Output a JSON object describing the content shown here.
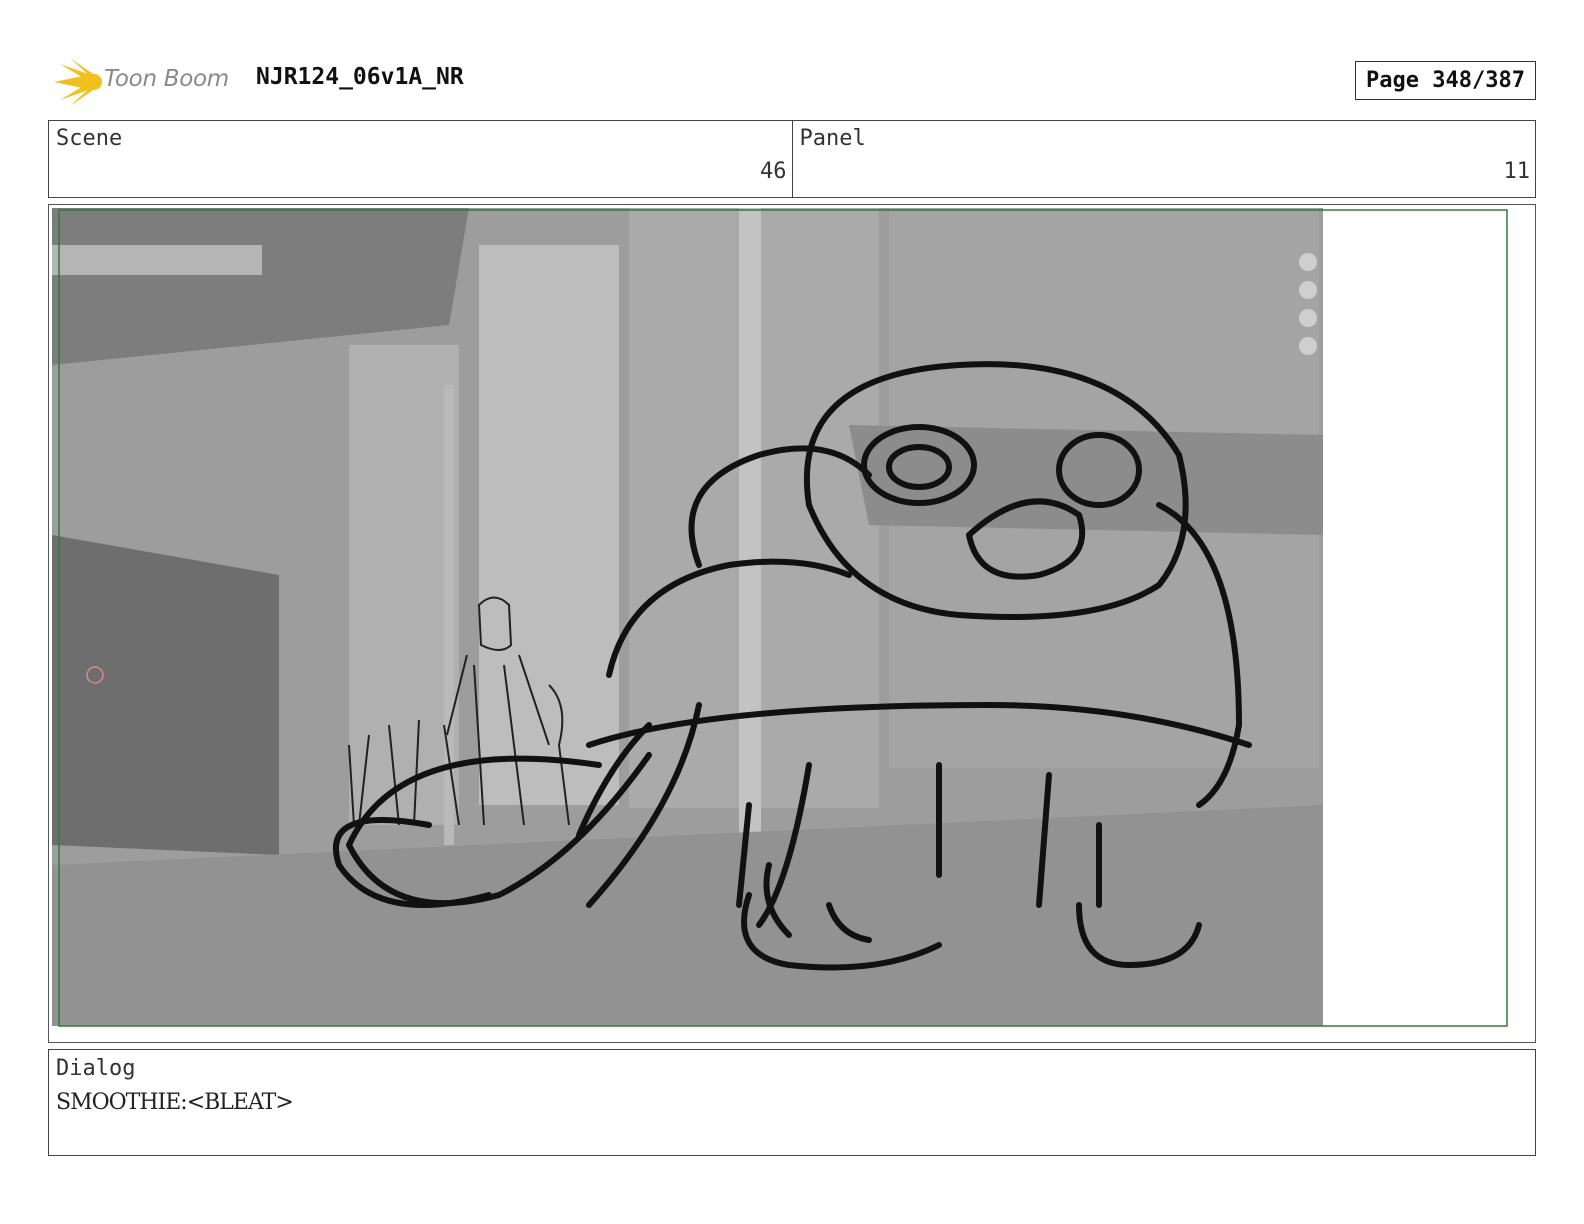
{
  "header": {
    "brand": "Toon Boom",
    "project_title": "NJR124_06v1A_NR",
    "page_label": "Page 348/387"
  },
  "scene": {
    "label": "Scene",
    "value": "46"
  },
  "panel": {
    "label": "Panel",
    "value": "11"
  },
  "dialog": {
    "label": "Dialog",
    "text": "SMOOTHIE:<BLEAT>"
  },
  "colors": {
    "logo_yellow": "#f2c01e",
    "safe_frame_green": "#2e7d32",
    "background_gray": "#9d9d9d"
  },
  "viewport_tools": [
    "zoom-icon",
    "hand-icon",
    "camera-icon",
    "grid-icon"
  ]
}
